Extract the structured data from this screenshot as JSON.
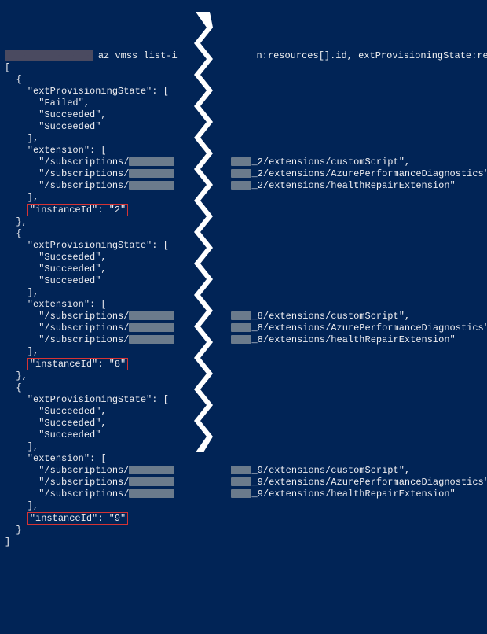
{
  "command": {
    "visible_text": "az vmss list-i",
    "right_fragment": "n:resources[].id, extProvisioningState:resources[]"
  },
  "instances": [
    {
      "extProvisioningState": [
        "Failed",
        "Succeeded",
        "Succeeded"
      ],
      "suffix": "_2",
      "extensions": [
        "customScript",
        "AzurePerformanceDiagnostics",
        "healthRepairExtension"
      ],
      "instanceId": "2"
    },
    {
      "extProvisioningState": [
        "Succeeded",
        "Succeeded",
        "Succeeded"
      ],
      "suffix": "_8",
      "extensions": [
        "customScript",
        "AzurePerformanceDiagnostics",
        "healthRepairExtension"
      ],
      "instanceId": "8"
    },
    {
      "extProvisioningState": [
        "Succeeded",
        "Succeeded",
        "Succeeded"
      ],
      "suffix": "_9",
      "extensions": [
        "customScript",
        "AzurePerformanceDiagnostics",
        "healthRepairExtension"
      ],
      "instanceId": "9"
    }
  ],
  "labels": {
    "extProvisioningState": "extProvisioningState",
    "extension": "extension",
    "instanceId": "instanceId",
    "subscriptions_prefix": "/subscriptions/",
    "extensions_path": "/extensions/"
  }
}
